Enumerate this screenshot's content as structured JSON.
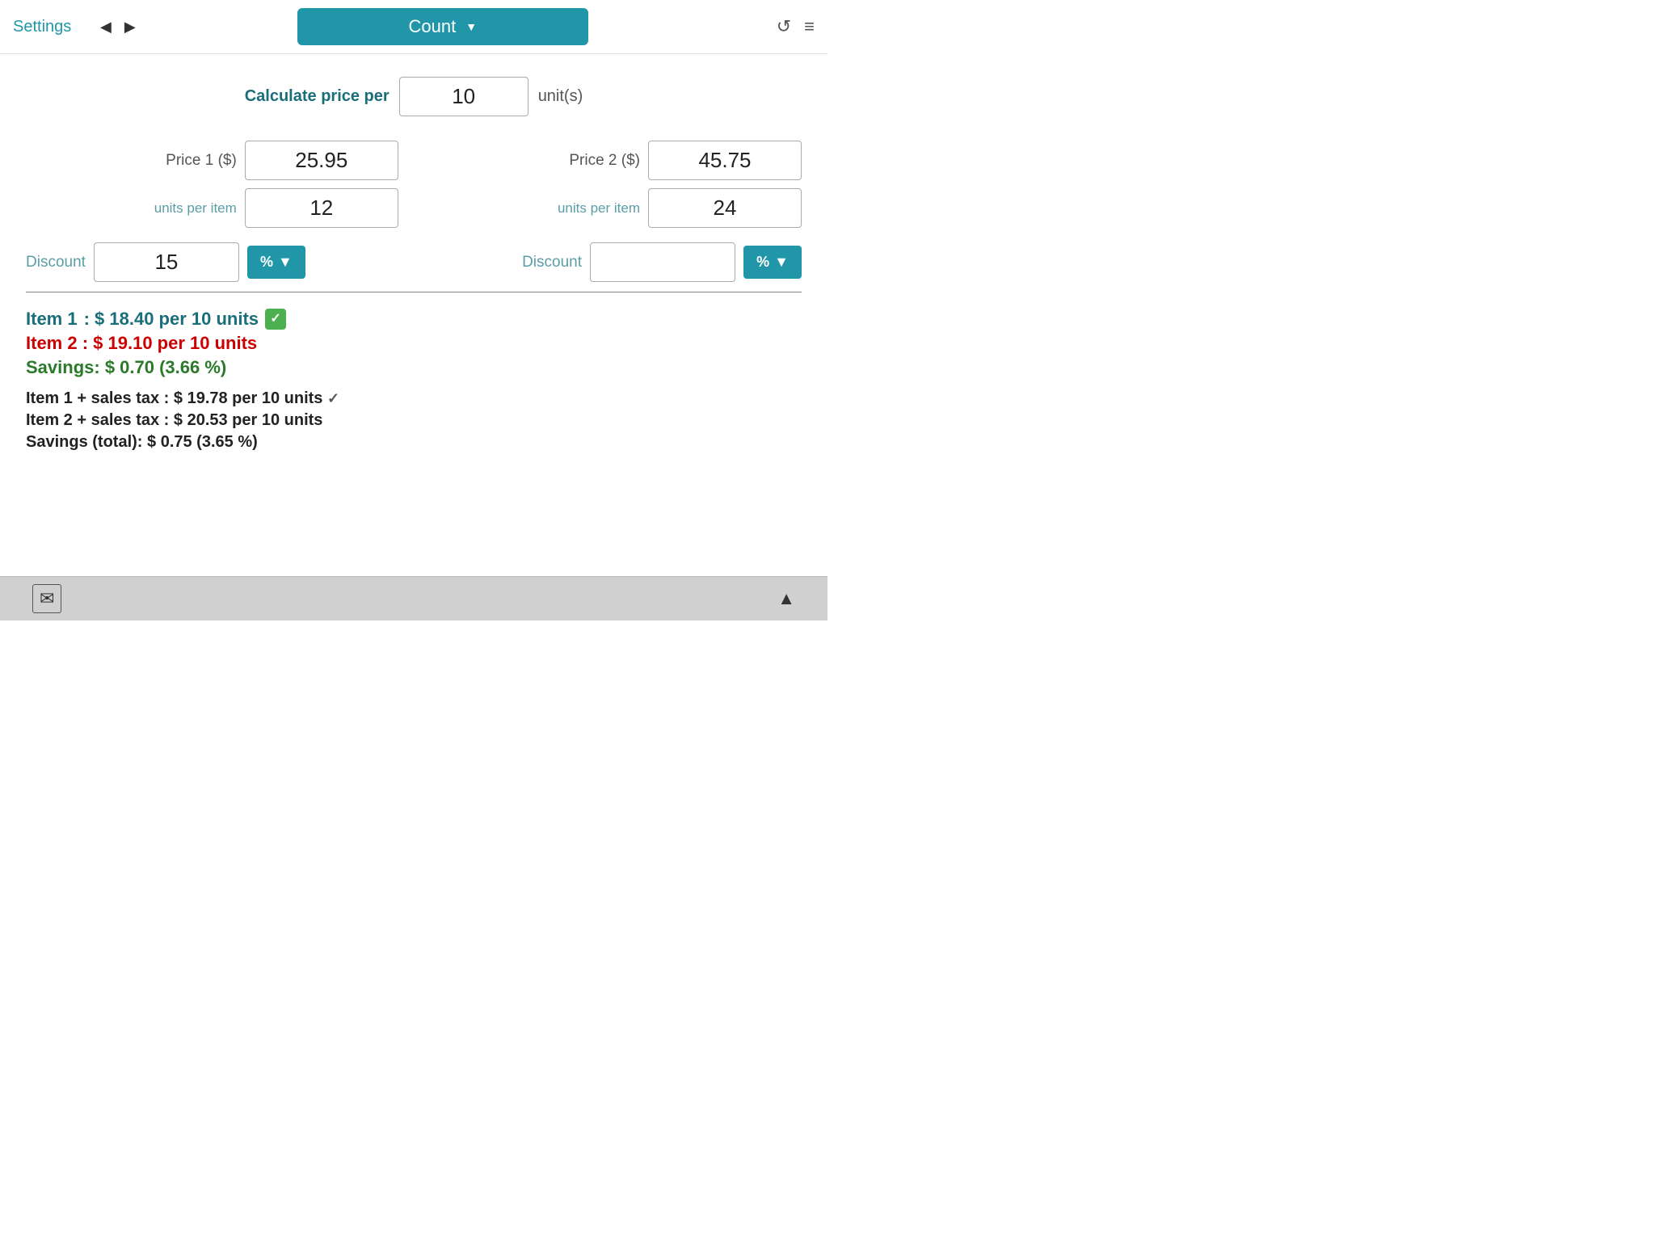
{
  "header": {
    "settings_label": "Settings",
    "nav_back": "◀",
    "nav_forward": "▶",
    "title": "Count",
    "dropdown_arrow": "▼",
    "refresh_icon": "↺",
    "menu_icon": "≡"
  },
  "form": {
    "calc_price_label": "Calculate price per",
    "calc_value": "10",
    "calc_units": "unit(s)",
    "price1_label": "Price 1",
    "price1_currency": "($)",
    "price1_value": "25.95",
    "units_per_item_label1": "units per item",
    "units1_value": "12",
    "price2_label": "Price 2",
    "price2_currency": "($)",
    "price2_value": "45.75",
    "units_per_item_label2": "units per item",
    "units2_value": "24",
    "discount1_label": "Discount",
    "discount1_value": "15",
    "discount1_type": "%",
    "discount2_label": "Discount",
    "discount2_value": "",
    "discount2_type": "%"
  },
  "results": {
    "item1_prefix": "Item 1",
    "item1_value": ": $ 18.40 per 10 units",
    "item2_prefix": "Item 2",
    "item2_value": ": $ 19.10 per 10 units",
    "savings_prefix": "Savings:",
    "savings_value": " $ 0.70 (3.66 %)",
    "item1_tax_prefix": "Item 1 + sales tax",
    "item1_tax_value": ": $ 19.78 per 10 units",
    "item1_tax_check": "✓",
    "item2_tax_prefix": "Item 2 + sales tax",
    "item2_tax_value": ": $ 20.53 per 10 units",
    "savings_total_partial": "Savings (total): $ 0.75 (3.65 %)"
  },
  "bottom": {
    "mail_icon": "✉",
    "up_icon": "▲"
  }
}
